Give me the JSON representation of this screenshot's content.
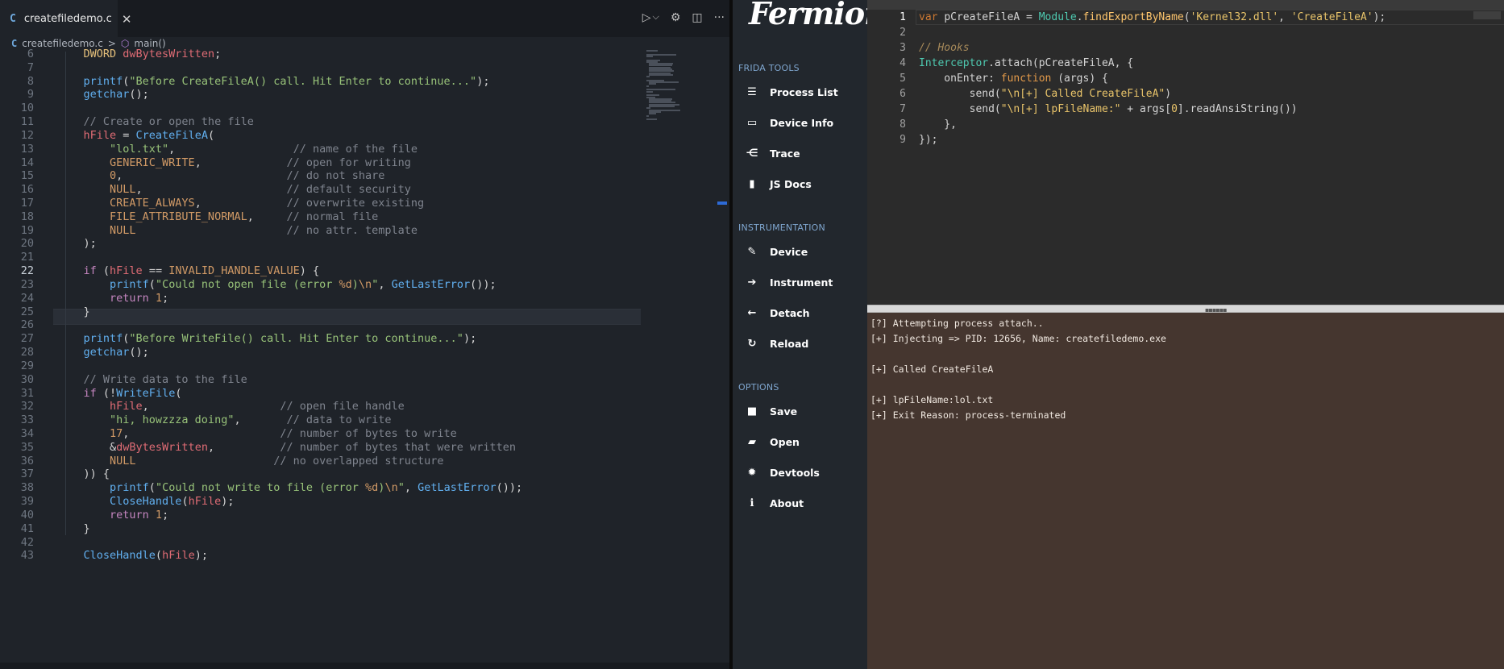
{
  "vscode": {
    "tab": {
      "icon": "C",
      "label": "createfiledemo.c",
      "close": "✕"
    },
    "actions": {
      "run": "▷",
      "run_menu": "⌵",
      "settings": "⚙",
      "split": "◫",
      "more": "···"
    },
    "breadcrumb": {
      "icon": "C",
      "file": "createfiledemo.c",
      "sep": ">",
      "symbol_icon": "⬡",
      "symbol": "main()"
    },
    "current_line": "22",
    "lines": [
      {
        "n": "6",
        "code": [
          [
            "ty",
            "    DWORD "
          ],
          [
            "va",
            "dwBytesWritten"
          ],
          [
            "pu",
            ";"
          ]
        ]
      },
      {
        "n": "7",
        "code": []
      },
      {
        "n": "8",
        "code": [
          [
            "fn",
            "    printf"
          ],
          [
            "pu",
            "("
          ],
          [
            "st",
            "\"Before CreateFileA() call. Hit Enter to continue...\""
          ],
          [
            "pu",
            ");"
          ]
        ]
      },
      {
        "n": "9",
        "code": [
          [
            "fn",
            "    getchar"
          ],
          [
            "pu",
            "();"
          ]
        ]
      },
      {
        "n": "10",
        "code": []
      },
      {
        "n": "11",
        "code": [
          [
            "cm",
            "    // Create or open the file"
          ]
        ]
      },
      {
        "n": "12",
        "code": [
          [
            "va",
            "    hFile"
          ],
          [
            "pu",
            " = "
          ],
          [
            "fn",
            "CreateFileA"
          ],
          [
            "pu",
            "("
          ]
        ]
      },
      {
        "n": "13",
        "code": [
          [
            "st",
            "        \"lol.txt\""
          ],
          [
            "pu",
            ",                  "
          ],
          [
            "cm",
            "// name of the file"
          ]
        ]
      },
      {
        "n": "14",
        "code": [
          [
            "mc",
            "        GENERIC_WRITE"
          ],
          [
            "pu",
            ",             "
          ],
          [
            "cm",
            "// open for writing"
          ]
        ]
      },
      {
        "n": "15",
        "code": [
          [
            "nu",
            "        0"
          ],
          [
            "pu",
            ",                         "
          ],
          [
            "cm",
            "// do not share"
          ]
        ]
      },
      {
        "n": "16",
        "code": [
          [
            "mc",
            "        NULL"
          ],
          [
            "pu",
            ",                      "
          ],
          [
            "cm",
            "// default security"
          ]
        ]
      },
      {
        "n": "17",
        "code": [
          [
            "mc",
            "        CREATE_ALWAYS"
          ],
          [
            "pu",
            ",             "
          ],
          [
            "cm",
            "// overwrite existing"
          ]
        ]
      },
      {
        "n": "18",
        "code": [
          [
            "mc",
            "        FILE_ATTRIBUTE_NORMAL"
          ],
          [
            "pu",
            ",     "
          ],
          [
            "cm",
            "// normal file"
          ]
        ]
      },
      {
        "n": "19",
        "code": [
          [
            "mc",
            "        NULL"
          ],
          [
            "pu",
            "                       "
          ],
          [
            "cm",
            "// no attr. template"
          ]
        ]
      },
      {
        "n": "20",
        "code": [
          [
            "pu",
            "    );"
          ]
        ]
      },
      {
        "n": "21",
        "code": []
      },
      {
        "n": "22",
        "code": [
          [
            "kw",
            "    if"
          ],
          [
            "pu",
            " ("
          ],
          [
            "va",
            "hFile"
          ],
          [
            "pu",
            " == "
          ],
          [
            "mc",
            "INVALID_HANDLE_VALUE"
          ],
          [
            "pu",
            ") {"
          ]
        ]
      },
      {
        "n": "23",
        "code": [
          [
            "fn",
            "        printf"
          ],
          [
            "pu",
            "("
          ],
          [
            "st",
            "\"Could not open file (error "
          ],
          [
            "mc",
            "%d"
          ],
          [
            "st",
            ")"
          ],
          [
            "mc",
            "\\n"
          ],
          [
            "st",
            "\""
          ],
          [
            "pu",
            ", "
          ],
          [
            "fn",
            "GetLastError"
          ],
          [
            "pu",
            "());"
          ]
        ]
      },
      {
        "n": "24",
        "code": [
          [
            "kw",
            "        return"
          ],
          [
            "nu",
            " 1"
          ],
          [
            "pu",
            ";"
          ]
        ]
      },
      {
        "n": "25",
        "code": [
          [
            "pu",
            "    }"
          ]
        ]
      },
      {
        "n": "26",
        "code": []
      },
      {
        "n": "27",
        "code": [
          [
            "fn",
            "    printf"
          ],
          [
            "pu",
            "("
          ],
          [
            "st",
            "\"Before WriteFile() call. Hit Enter to continue...\""
          ],
          [
            "pu",
            ");"
          ]
        ]
      },
      {
        "n": "28",
        "code": [
          [
            "fn",
            "    getchar"
          ],
          [
            "pu",
            "();"
          ]
        ]
      },
      {
        "n": "29",
        "code": []
      },
      {
        "n": "30",
        "code": [
          [
            "cm",
            "    // Write data to the file"
          ]
        ]
      },
      {
        "n": "31",
        "code": [
          [
            "kw",
            "    if"
          ],
          [
            "pu",
            " (!"
          ],
          [
            "fn",
            "WriteFile"
          ],
          [
            "pu",
            "("
          ]
        ]
      },
      {
        "n": "32",
        "code": [
          [
            "va",
            "        hFile"
          ],
          [
            "pu",
            ",                    "
          ],
          [
            "cm",
            "// open file handle"
          ]
        ]
      },
      {
        "n": "33",
        "code": [
          [
            "st",
            "        \"hi, howzzza doing\""
          ],
          [
            "pu",
            ",       "
          ],
          [
            "cm",
            "// data to write"
          ]
        ]
      },
      {
        "n": "34",
        "code": [
          [
            "nu",
            "        17"
          ],
          [
            "pu",
            ",                       "
          ],
          [
            "cm",
            "// number of bytes to write"
          ]
        ]
      },
      {
        "n": "35",
        "code": [
          [
            "pu",
            "        &"
          ],
          [
            "va",
            "dwBytesWritten"
          ],
          [
            "pu",
            ",          "
          ],
          [
            "cm",
            "// number of bytes that were written"
          ]
        ]
      },
      {
        "n": "36",
        "code": [
          [
            "mc",
            "        NULL"
          ],
          [
            "pu",
            "                     "
          ],
          [
            "cm",
            "// no overlapped structure"
          ]
        ]
      },
      {
        "n": "37",
        "code": [
          [
            "pu",
            "    )) {"
          ]
        ]
      },
      {
        "n": "38",
        "code": [
          [
            "fn",
            "        printf"
          ],
          [
            "pu",
            "("
          ],
          [
            "st",
            "\"Could not write to file (error "
          ],
          [
            "mc",
            "%d"
          ],
          [
            "st",
            ")"
          ],
          [
            "mc",
            "\\n"
          ],
          [
            "st",
            "\""
          ],
          [
            "pu",
            ", "
          ],
          [
            "fn",
            "GetLastError"
          ],
          [
            "pu",
            "());"
          ]
        ]
      },
      {
        "n": "39",
        "code": [
          [
            "fn",
            "        CloseHandle"
          ],
          [
            "pu",
            "("
          ],
          [
            "va",
            "hFile"
          ],
          [
            "pu",
            ");"
          ]
        ]
      },
      {
        "n": "40",
        "code": [
          [
            "kw",
            "        return"
          ],
          [
            "nu",
            " 1"
          ],
          [
            "pu",
            ";"
          ]
        ]
      },
      {
        "n": "41",
        "code": [
          [
            "pu",
            "    }"
          ]
        ]
      },
      {
        "n": "42",
        "code": []
      },
      {
        "n": "43",
        "code": [
          [
            "fn",
            "    CloseHandle"
          ],
          [
            "pu",
            "("
          ],
          [
            "va",
            "hFile"
          ],
          [
            "pu",
            ");"
          ]
        ]
      }
    ]
  },
  "fermion": {
    "logo": "Fermion",
    "sections": [
      {
        "title": "FRIDA TOOLS",
        "items": [
          {
            "icon": "☰",
            "label": "Process List",
            "icon_name": "list-icon"
          },
          {
            "icon": "▭",
            "label": "Device Info",
            "icon_name": "monitor-icon"
          },
          {
            "icon": "⋲",
            "label": "Trace",
            "icon_name": "trace-icon"
          },
          {
            "icon": "▮",
            "label": "JS Docs",
            "icon_name": "book-icon"
          }
        ]
      },
      {
        "title": "INSTRUMENTATION",
        "items": [
          {
            "icon": "✎",
            "label": "Device",
            "icon_name": "pencil-icon"
          },
          {
            "icon": "➔",
            "label": "Instrument",
            "icon_name": "arrow-circle-icon"
          },
          {
            "icon": "←",
            "label": "Detach",
            "icon_name": "detach-icon"
          },
          {
            "icon": "↻",
            "label": "Reload",
            "icon_name": "reload-icon"
          }
        ]
      },
      {
        "title": "OPTIONS",
        "items": [
          {
            "icon": "■",
            "label": "Save",
            "icon_name": "save-icon"
          },
          {
            "icon": "▰",
            "label": "Open",
            "icon_name": "folder-icon"
          },
          {
            "icon": "✹",
            "label": "Devtools",
            "icon_name": "bug-icon"
          },
          {
            "icon": "ℹ",
            "label": "About",
            "icon_name": "info-icon"
          }
        ]
      }
    ]
  },
  "editor": {
    "current_line": "1",
    "lines": [
      {
        "n": "1",
        "code": [
          [
            "ekw",
            "var "
          ],
          [
            "pu",
            "pCreateFileA = "
          ],
          [
            "emod",
            "Module"
          ],
          [
            "pu",
            "."
          ],
          [
            "efn",
            "findExportByName"
          ],
          [
            "pu",
            "("
          ],
          [
            "estr",
            "'Kernel32.dll'"
          ],
          [
            "pu",
            ", "
          ],
          [
            "estr",
            "'CreateFileA'"
          ],
          [
            "pu",
            ");"
          ]
        ]
      },
      {
        "n": "2",
        "code": []
      },
      {
        "n": "3",
        "code": [
          [
            "ecm",
            "// Hooks"
          ]
        ]
      },
      {
        "n": "4",
        "code": [
          [
            "emod",
            "Interceptor"
          ],
          [
            "pu",
            ".attach(pCreateFileA, {"
          ]
        ]
      },
      {
        "n": "5",
        "code": [
          [
            "pu",
            "    onEnter: "
          ],
          [
            "eor",
            "function"
          ],
          [
            "pu",
            " (args) {"
          ]
        ]
      },
      {
        "n": "6",
        "code": [
          [
            "pu",
            "        send("
          ],
          [
            "estr",
            "\"\\n[+] Called CreateFileA\""
          ],
          [
            "pu",
            ")"
          ]
        ]
      },
      {
        "n": "7",
        "code": [
          [
            "pu",
            "        send("
          ],
          [
            "estr",
            "\"\\n[+] lpFileName:\""
          ],
          [
            "pu",
            " + args["
          ],
          [
            "estr",
            "0"
          ],
          [
            "pu",
            "].readAnsiString())"
          ]
        ]
      },
      {
        "n": "8",
        "code": [
          [
            "pu",
            "    },"
          ]
        ]
      },
      {
        "n": "9",
        "code": [
          [
            "pu",
            "});"
          ]
        ]
      }
    ]
  },
  "console": {
    "lines": [
      "[?] Attempting process attach..",
      "[+] Injecting => PID: 12656, Name: createfiledemo.exe",
      "",
      "[+] Called CreateFileA",
      "",
      "[+] lpFileName:lol.txt",
      "[+] Exit Reason: process-terminated"
    ]
  }
}
